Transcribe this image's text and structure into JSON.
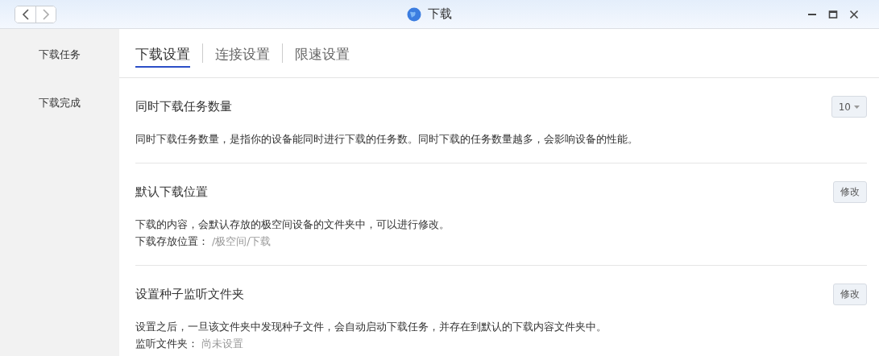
{
  "window": {
    "title": "下载"
  },
  "sidebar": {
    "items": [
      {
        "label": "下载任务",
        "selected": false
      },
      {
        "label": "下载完成",
        "selected": false
      }
    ]
  },
  "tabs": [
    {
      "label": "下载设置",
      "selected": true
    },
    {
      "label": "连接设置",
      "selected": false
    },
    {
      "label": "限速设置",
      "selected": false
    }
  ],
  "sections": [
    {
      "title": "同时下载任务数量",
      "kind": "dropdown",
      "control": "10",
      "description": "同时下载任务数量，是指你的设备能同时进行下载的任务数。同时下载的任务数量越多，会影响设备的性能。"
    },
    {
      "title": "默认下载位置",
      "kind": "button",
      "control": "修改",
      "description": "下载的内容，会默认存放的极空间设备的文件夹中，可以进行修改。",
      "field_label": "下载存放位置：",
      "field_value": "/极空间/下载"
    },
    {
      "title": "设置种子监听文件夹",
      "kind": "button",
      "control": "修改",
      "description": "设置之后，一旦该文件夹中发现种子文件，会自动启动下载任务，并存在到默认的下载内容文件夹中。",
      "field_label": "监听文件夹：",
      "field_value": "尚未设置"
    }
  ]
}
